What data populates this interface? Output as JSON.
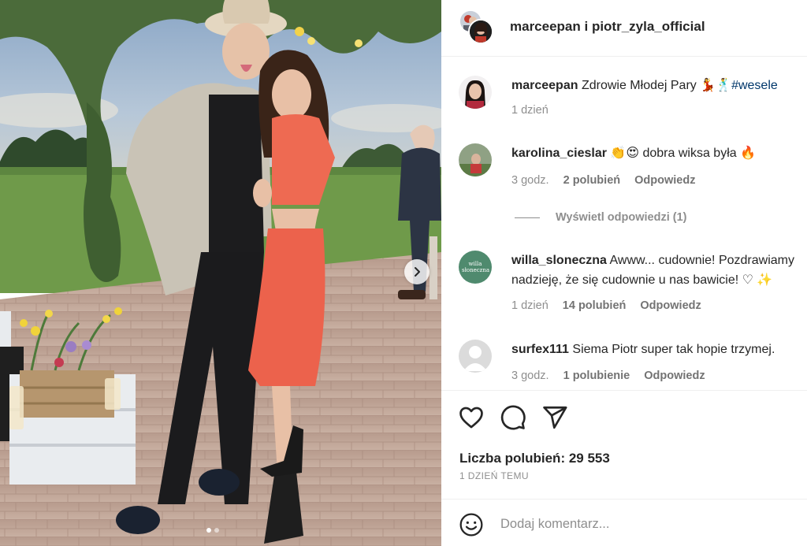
{
  "header": {
    "title": "marceepan i piotr_zyla_official",
    "avatar_icons": [
      "marceepan-avatar",
      "piotr-zyla-avatar"
    ]
  },
  "photo": {
    "next_icon": "chevron-right-icon",
    "carousel": {
      "count": 2,
      "active": 1
    }
  },
  "comments": [
    {
      "username": "marceepan",
      "text": "Zdrowie Młodej Pary 💃🕺",
      "hashtag": "#wesele",
      "time": "1 dzień",
      "likes": "",
      "reply": ""
    },
    {
      "username": "karolina_cieslar",
      "text": "👏😍 dobra wiksa była 🔥",
      "time": "3 godz.",
      "likes": "2 polubień",
      "reply": "Odpowiedz",
      "view_replies": "Wyświetl odpowiedzi (1)"
    },
    {
      "username": "willa_sloneczna",
      "text": "Awww... cudownie! Pozdrawiamy",
      "text2": "nadzieję, że się cudownie u nas bawicie! ♡ ✨",
      "time": "1 dzień",
      "likes": "14 polubień",
      "reply": "Odpowiedz",
      "avatar_text": "willa słoneczna"
    },
    {
      "username": "surfex111",
      "text": "Siema Piotr super tak hopie trzymej.",
      "time": "3 godz.",
      "likes": "1 polubienie",
      "reply": "Odpowiedz"
    }
  ],
  "actions": {
    "icons": [
      "heart-icon",
      "comment-icon",
      "share-icon"
    ],
    "likes_label": "Liczba polubień: 29 553",
    "posted": "1 DZIEŃ TEMU"
  },
  "add_comment": {
    "placeholder": "Dodaj komentarz...",
    "emoji_icon": "smiley-icon"
  },
  "colors": {
    "text": "#262626",
    "secondary": "#8e8e8e",
    "link": "#00376b",
    "divider": "#efefef",
    "willa_avatar": "#4f8a6e"
  }
}
